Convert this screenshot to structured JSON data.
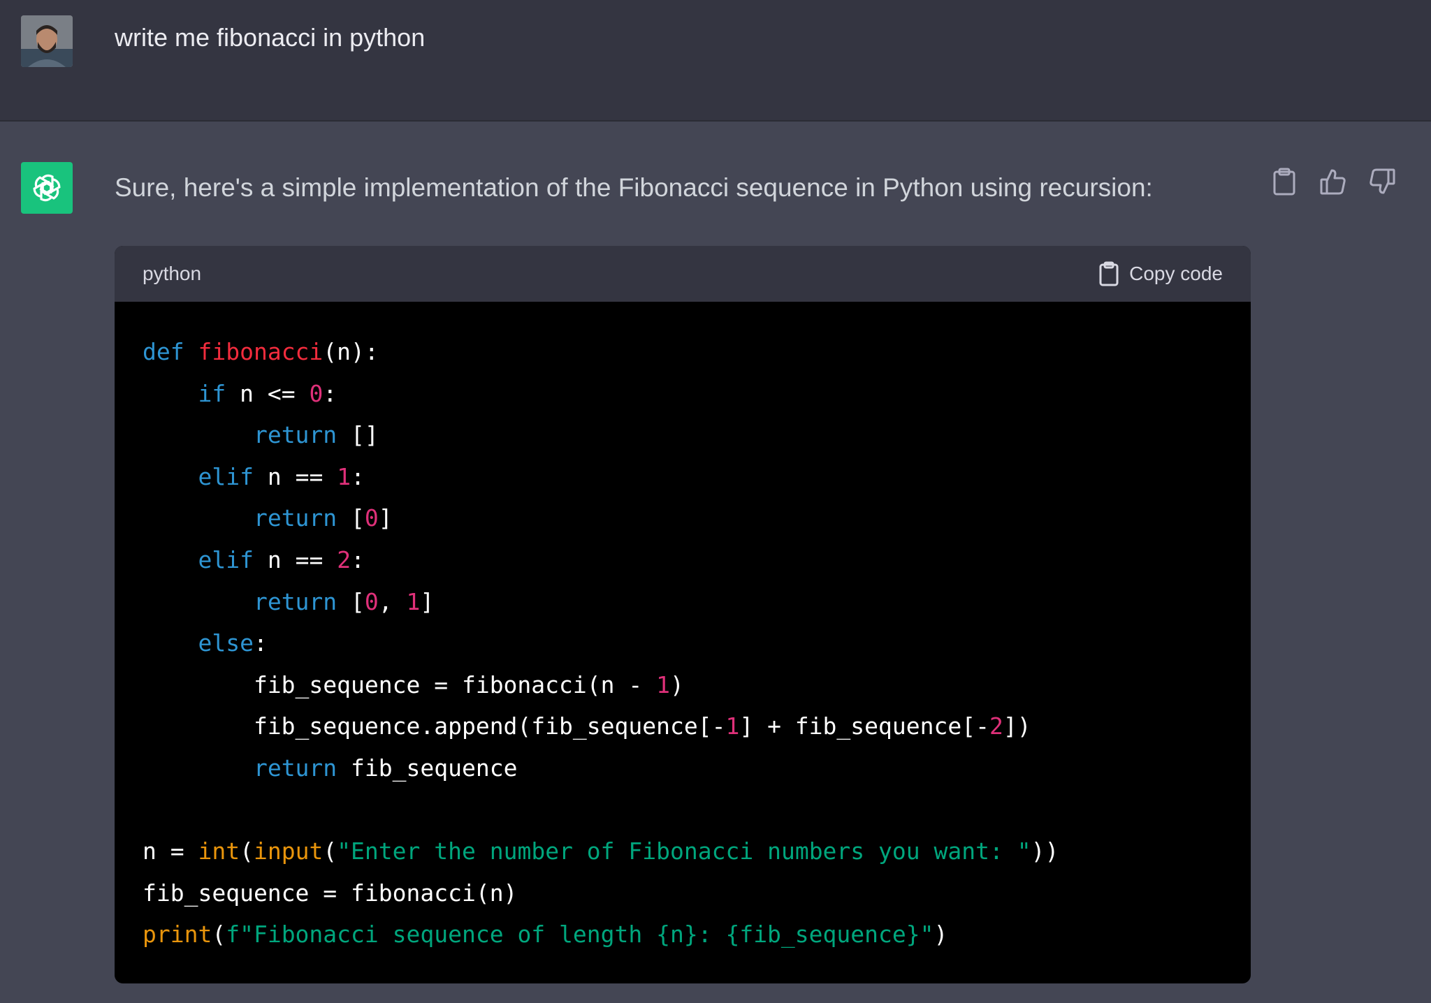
{
  "user_message": {
    "text": "write me fibonacci in python"
  },
  "assistant_message": {
    "text": "Sure, here's a simple implementation of the Fibonacci sequence in Python using recursion:",
    "code_block": {
      "language": "python",
      "copy_label": "Copy code",
      "lines": [
        [
          {
            "t": "def",
            "c": "kw"
          },
          {
            "t": " "
          },
          {
            "t": "fibonacci",
            "c": "fn"
          },
          {
            "t": "(n):"
          }
        ],
        [
          {
            "t": "    "
          },
          {
            "t": "if",
            "c": "kw"
          },
          {
            "t": " n <= "
          },
          {
            "t": "0",
            "c": "num"
          },
          {
            "t": ":"
          }
        ],
        [
          {
            "t": "        "
          },
          {
            "t": "return",
            "c": "kw"
          },
          {
            "t": " []"
          }
        ],
        [
          {
            "t": "    "
          },
          {
            "t": "elif",
            "c": "kw"
          },
          {
            "t": " n == "
          },
          {
            "t": "1",
            "c": "num"
          },
          {
            "t": ":"
          }
        ],
        [
          {
            "t": "        "
          },
          {
            "t": "return",
            "c": "kw"
          },
          {
            "t": " ["
          },
          {
            "t": "0",
            "c": "num"
          },
          {
            "t": "]"
          }
        ],
        [
          {
            "t": "    "
          },
          {
            "t": "elif",
            "c": "kw"
          },
          {
            "t": " n == "
          },
          {
            "t": "2",
            "c": "num"
          },
          {
            "t": ":"
          }
        ],
        [
          {
            "t": "        "
          },
          {
            "t": "return",
            "c": "kw"
          },
          {
            "t": " ["
          },
          {
            "t": "0",
            "c": "num"
          },
          {
            "t": ", "
          },
          {
            "t": "1",
            "c": "num"
          },
          {
            "t": "]"
          }
        ],
        [
          {
            "t": "    "
          },
          {
            "t": "else",
            "c": "kw"
          },
          {
            "t": ":"
          }
        ],
        [
          {
            "t": "        fib_sequence = fibonacci(n - "
          },
          {
            "t": "1",
            "c": "num"
          },
          {
            "t": ")"
          }
        ],
        [
          {
            "t": "        fib_sequence.append(fib_sequence[-"
          },
          {
            "t": "1",
            "c": "num"
          },
          {
            "t": "] + fib_sequence[-"
          },
          {
            "t": "2",
            "c": "num"
          },
          {
            "t": "])"
          }
        ],
        [
          {
            "t": "        "
          },
          {
            "t": "return",
            "c": "kw"
          },
          {
            "t": " fib_sequence"
          }
        ],
        [],
        [
          {
            "t": "n = "
          },
          {
            "t": "int",
            "c": "bi"
          },
          {
            "t": "("
          },
          {
            "t": "input",
            "c": "bi"
          },
          {
            "t": "("
          },
          {
            "t": "\"Enter the number of Fibonacci numbers you want: \"",
            "c": "str"
          },
          {
            "t": "))"
          }
        ],
        [
          {
            "t": "fib_sequence = fibonacci(n)"
          }
        ],
        [
          {
            "t": "print",
            "c": "bi"
          },
          {
            "t": "("
          },
          {
            "t": "f\"Fibonacci sequence of length {n}: {fib_sequence}\"",
            "c": "str"
          },
          {
            "t": ")"
          }
        ]
      ]
    }
  },
  "icons": {
    "clipboard": "clipboard-icon",
    "thumbs_up": "thumbs-up-icon",
    "thumbs_down": "thumbs-down-icon",
    "assistant_logo": "openai-logo-icon"
  },
  "colors": {
    "user_bg": "#343541",
    "assistant_bg": "#444654",
    "code_header_bg": "#343541",
    "code_bg": "#000000",
    "assistant_avatar": "#19c37d",
    "keyword": "#2e95d3",
    "function_name": "#f22c3d",
    "number": "#df3079",
    "builtin": "#e9950c",
    "string": "#00a67d"
  }
}
